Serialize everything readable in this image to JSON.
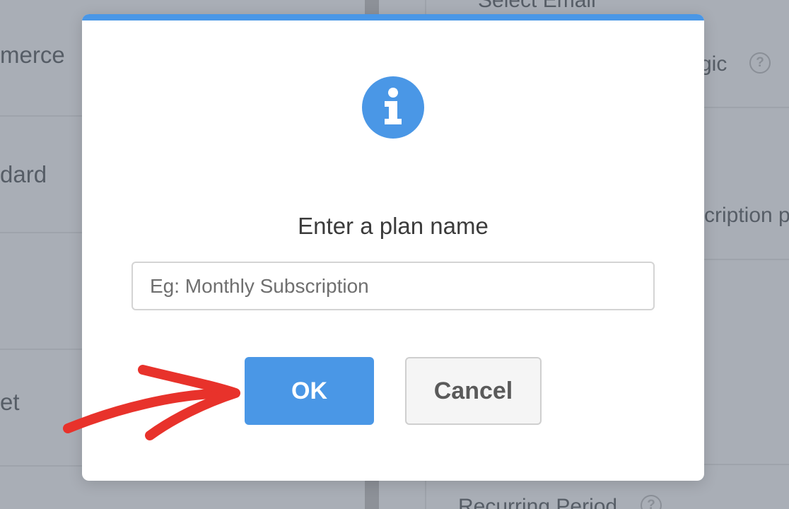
{
  "background": {
    "left_rows": [
      "merce",
      "dard",
      "",
      "et"
    ],
    "right_top_text": "Select Email",
    "right_row1_text": "gic",
    "right_row2_text": "cription p",
    "right_bottom_text": "Recurring Period",
    "help_glyph": "?"
  },
  "modal": {
    "icon": "info-icon",
    "title": "Enter a plan name",
    "input": {
      "placeholder": "Eg: Monthly Subscription",
      "value": ""
    },
    "ok_label": "OK",
    "cancel_label": "Cancel"
  },
  "annotation": {
    "icon": "red-arrow-icon",
    "color": "#e8322b"
  },
  "colors": {
    "accent": "#4a97e6",
    "overlay": "#a9aeb6"
  }
}
